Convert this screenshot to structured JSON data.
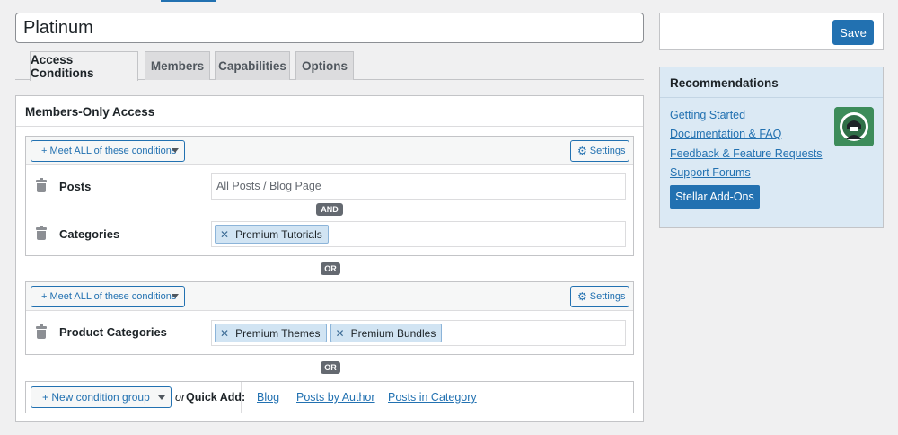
{
  "title_input": {
    "value": "Platinum"
  },
  "tabs": [
    {
      "label": "Access Conditions"
    },
    {
      "label": "Members"
    },
    {
      "label": "Capabilities"
    },
    {
      "label": "Options"
    }
  ],
  "panel": {
    "title": "Members-Only Access",
    "groups": [
      {
        "meet_label": "+ Meet ALL of these conditions",
        "settings_label": "Settings",
        "conditions": [
          {
            "label": "Posts",
            "placeholder": "All Posts / Blog Page"
          },
          {
            "label": "Categories",
            "tags": [
              "Premium Tutorials"
            ]
          }
        ],
        "joiner": "AND"
      },
      {
        "meet_label": "+ Meet ALL of these conditions",
        "settings_label": "Settings",
        "conditions": [
          {
            "label": "Product Categories",
            "tags": [
              "Premium Themes",
              "Premium Bundles"
            ]
          }
        ]
      }
    ],
    "or_label": "OR",
    "new_group": {
      "button_label": "+ New condition group",
      "or_text": "or",
      "quick_add_label": "Quick Add:",
      "links": [
        "Blog",
        "Posts by Author",
        "Posts in Category"
      ]
    }
  },
  "sidebar": {
    "save_label": "Save",
    "recommendations": {
      "title": "Recommendations",
      "links": [
        "Getting Started",
        "Documentation & FAQ",
        "Feedback & Feature Requests",
        "Support Forums"
      ],
      "button_label": "Stellar Add-Ons"
    }
  },
  "colors": {
    "accent": "#2271b1",
    "tag_bg": "#d1e4f3",
    "recommend_bg": "#dbe9f4",
    "logo_bg": "#3d8c5a"
  }
}
